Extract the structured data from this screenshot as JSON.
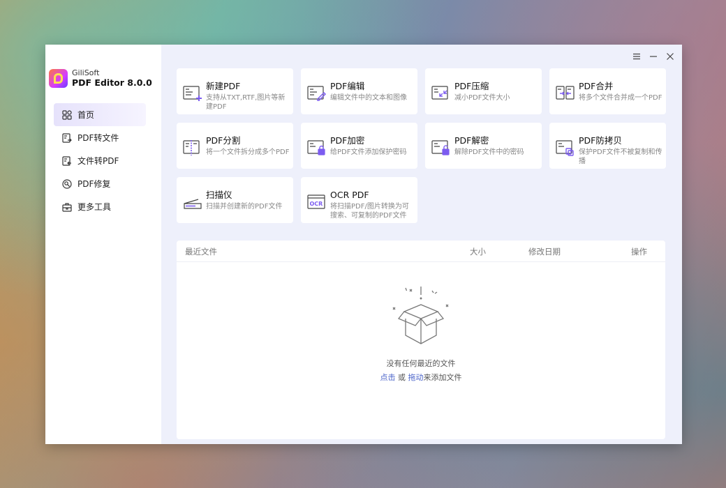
{
  "brand": {
    "company": "GiliSoft",
    "product": "PDF Editor 8.0.0"
  },
  "sidebar": {
    "items": [
      {
        "label": "首页",
        "icon": "home-grid-icon",
        "active": true
      },
      {
        "label": "PDF转文件",
        "icon": "pdf-to-file-icon",
        "active": false
      },
      {
        "label": "文件转PDF",
        "icon": "file-to-pdf-icon",
        "active": false
      },
      {
        "label": "PDF修复",
        "icon": "pdf-repair-icon",
        "active": false
      },
      {
        "label": "更多工具",
        "icon": "toolbox-icon",
        "active": false
      }
    ]
  },
  "window_controls": {
    "menu": "menu-icon",
    "minimize": "minimize-icon",
    "close": "close-icon"
  },
  "tools": [
    {
      "title": "新建PDF",
      "desc": "支持从TXT,RTF,图片等新建PDF",
      "icon": "new-pdf-icon"
    },
    {
      "title": "PDF编辑",
      "desc": "编辑文件中的文本和图像",
      "icon": "pdf-edit-icon"
    },
    {
      "title": "PDF压缩",
      "desc": "减小PDF文件大小",
      "icon": "pdf-compress-icon"
    },
    {
      "title": "PDF合并",
      "desc": "将多个文件合并成一个PDF",
      "icon": "pdf-merge-icon"
    },
    {
      "title": "PDF分割",
      "desc": "将一个文件拆分成多个PDF",
      "icon": "pdf-split-icon"
    },
    {
      "title": "PDF加密",
      "desc": "给PDF文件添加保护密码",
      "icon": "pdf-encrypt-icon"
    },
    {
      "title": "PDF解密",
      "desc": "解除PDF文件中的密码",
      "icon": "pdf-decrypt-icon"
    },
    {
      "title": "PDF防拷贝",
      "desc": "保护PDF文件不被复制和传播",
      "icon": "pdf-copy-protect-icon"
    },
    {
      "title": "扫描仪",
      "desc": "扫描并创建新的PDF文件",
      "icon": "scanner-icon"
    },
    {
      "title": "OCR PDF",
      "desc": "将扫描PDF/图片转换为可搜索、可复制的PDF文件",
      "icon": "ocr-icon"
    }
  ],
  "recent": {
    "columns": {
      "name": "最近文件",
      "size": "大小",
      "date": "修改日期",
      "action": "操作"
    },
    "empty": {
      "message": "没有任何最近的文件",
      "click_link": "点击",
      "or": "或",
      "drag_link": "拖动",
      "suffix": "来添加文件"
    }
  },
  "colors": {
    "accent": "#7c5cf0",
    "link": "#4a63c9",
    "active_nav_bg": "#e6e2fb",
    "main_bg": "#eef0fb"
  }
}
